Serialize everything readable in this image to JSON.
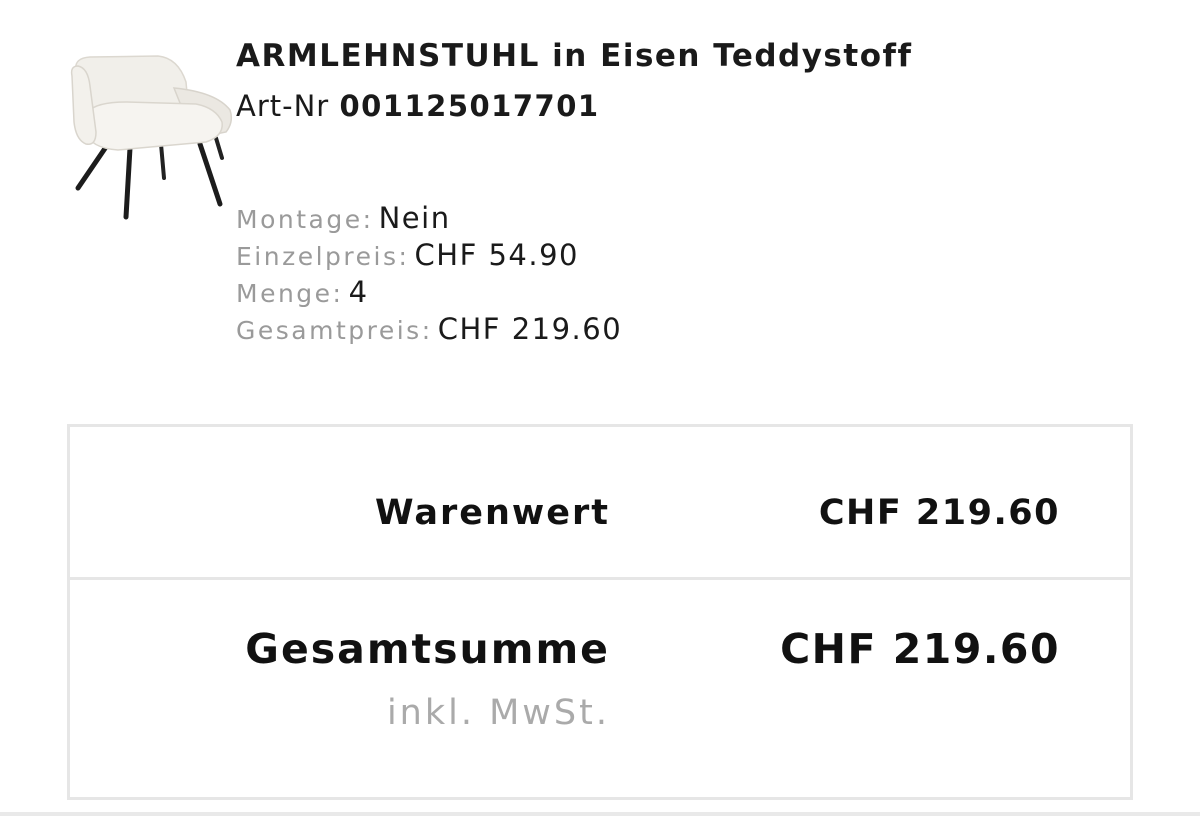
{
  "product": {
    "image_icon": "armchair-icon",
    "title": "ARMLEHNSTUHL in Eisen Teddystoff",
    "art_nr_label": "Art-Nr",
    "art_nr": "001125017701",
    "details": {
      "montage_label": "Montage:",
      "montage_value": "Nein",
      "unit_price_label": "Einzelpreis:",
      "unit_price_value": "CHF 54.90",
      "quantity_label": "Menge:",
      "quantity_value": "4",
      "total_label": "Gesamtpreis:",
      "total_value": "CHF 219.60"
    }
  },
  "summary": {
    "goods_value_label": "Warenwert",
    "goods_value": "CHF 219.60",
    "grand_total_label": "Gesamtsumme",
    "grand_total": "CHF 219.60",
    "tax_note": "inkl. MwSt."
  },
  "colors": {
    "text": "#111111",
    "muted": "#9a9a9a",
    "border": "#e6e6e6"
  }
}
